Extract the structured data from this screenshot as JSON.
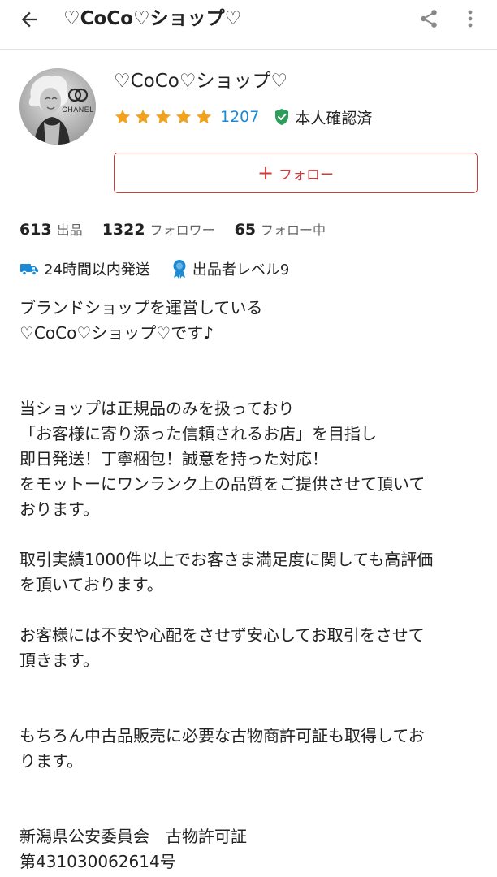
{
  "header": {
    "title": "♡CoCo♡ショップ♡",
    "back_icon": "arrow-left-icon",
    "share_icon": "share-icon",
    "more_icon": "more-vertical-icon"
  },
  "profile": {
    "name": "♡CoCo♡ショップ♡",
    "avatar_brand_text": "CHANEL",
    "rating_stars": 5,
    "rating_max": 5,
    "review_count": "1207",
    "verified_label": "本人確認済",
    "follow_label": "フォロー",
    "colors": {
      "star": "#f2a21b",
      "review_count": "#1a8ad4",
      "verified": "#2e9e5b",
      "follow": "#d23a3a",
      "badge": "#1a8ad4"
    }
  },
  "stats": [
    {
      "value": "613",
      "label": "出品"
    },
    {
      "value": "1322",
      "label": "フォロワー"
    },
    {
      "value": "65",
      "label": "フォロー中"
    }
  ],
  "badges": [
    {
      "icon": "truck-icon",
      "label": "24時間以内発送"
    },
    {
      "icon": "ribbon-icon",
      "label": "出品者レベル9"
    }
  ],
  "bio": "ブランドショップを運営している\n♡CoCo♡ショップ♡です♪\n\n\n当ショップは正規品のみを扱っており\n「お客様に寄り添った信頼されるお店」を目指し\n即日発送！丁寧梱包！誠意を持った対応！\nをモットーにワンランク上の品質をご提供させて頂いて\nおります。\n\n取引実績1000件以上でお客さま満足度に関しても高評価\nを頂いております。\n\nお客様には不安や心配をさせず安心してお取引をさせて\n頂きます。\n\n\nもちろん中古品販売に必要な古物商許可証も取得してお\nります。\n\n\n新潟県公安委員会　古物許可証\n第431030062614号"
}
